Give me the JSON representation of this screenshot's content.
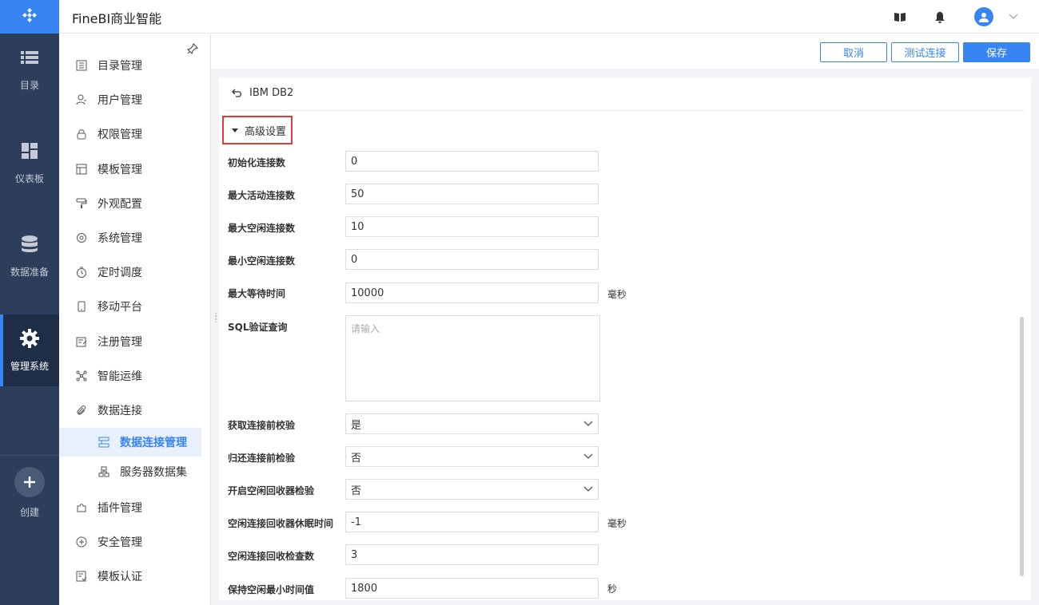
{
  "header": {
    "title": "FineBI商业智能"
  },
  "rail": [
    {
      "label": "目录",
      "icon": "list-icon"
    },
    {
      "label": "仪表板",
      "icon": "dashboard-icon"
    },
    {
      "label": "数据准备",
      "icon": "database-icon"
    },
    {
      "label": "管理系统",
      "icon": "gear-icon",
      "active": true
    },
    {
      "label": "创建",
      "icon": "plus-icon"
    }
  ],
  "subnav": {
    "items": [
      {
        "label": "目录管理",
        "icon": "catalog-icon"
      },
      {
        "label": "用户管理",
        "icon": "user-icon"
      },
      {
        "label": "权限管理",
        "icon": "lock-icon"
      },
      {
        "label": "模板管理",
        "icon": "template-icon"
      },
      {
        "label": "外观配置",
        "icon": "paint-icon"
      },
      {
        "label": "系统管理",
        "icon": "settings-icon"
      },
      {
        "label": "定时调度",
        "icon": "timer-icon"
      },
      {
        "label": "移动平台",
        "icon": "mobile-icon"
      },
      {
        "label": "注册管理",
        "icon": "register-icon"
      },
      {
        "label": "智能运维",
        "icon": "ops-icon"
      },
      {
        "label": "数据连接",
        "icon": "link-icon"
      },
      {
        "label": "数据连接管理",
        "icon": "connection-manage-icon",
        "sub": true,
        "selected": true
      },
      {
        "label": "服务器数据集",
        "icon": "server-dataset-icon",
        "sub": true
      },
      {
        "label": "插件管理",
        "icon": "plugin-icon"
      },
      {
        "label": "安全管理",
        "icon": "shield-icon"
      },
      {
        "label": "模板认证",
        "icon": "certify-icon"
      }
    ]
  },
  "actions": {
    "cancel": "取消",
    "test": "测试连接",
    "save": "保存"
  },
  "panel": {
    "db_name": "IBM DB2",
    "advanced_label": "高级设置",
    "fields": [
      {
        "label": "初始化连接数",
        "value": "0"
      },
      {
        "label": "最大活动连接数",
        "value": "50"
      },
      {
        "label": "最大空闲连接数",
        "value": "10"
      },
      {
        "label": "最小空闲连接数",
        "value": "0"
      },
      {
        "label": "最大等待时间",
        "value": "10000",
        "unit": "毫秒"
      },
      {
        "label": "SQL验证查询",
        "placeholder": "请输入"
      },
      {
        "label": "获取连接前校验",
        "value": "是"
      },
      {
        "label": "归还连接前检验",
        "value": "否"
      },
      {
        "label": "开启空闲回收器检验",
        "value": "否"
      },
      {
        "label": "空闲连接回收器休眠时间",
        "value": "-1",
        "unit": "毫秒"
      },
      {
        "label": "空闲连接回收检查数",
        "value": "3"
      },
      {
        "label": "保持空闲最小时间值",
        "value": "1800",
        "unit": "秒"
      }
    ]
  },
  "colors": {
    "accent": "#3685f2",
    "rail": "#2c3e5b",
    "highlight_box": "#e03b3b"
  }
}
